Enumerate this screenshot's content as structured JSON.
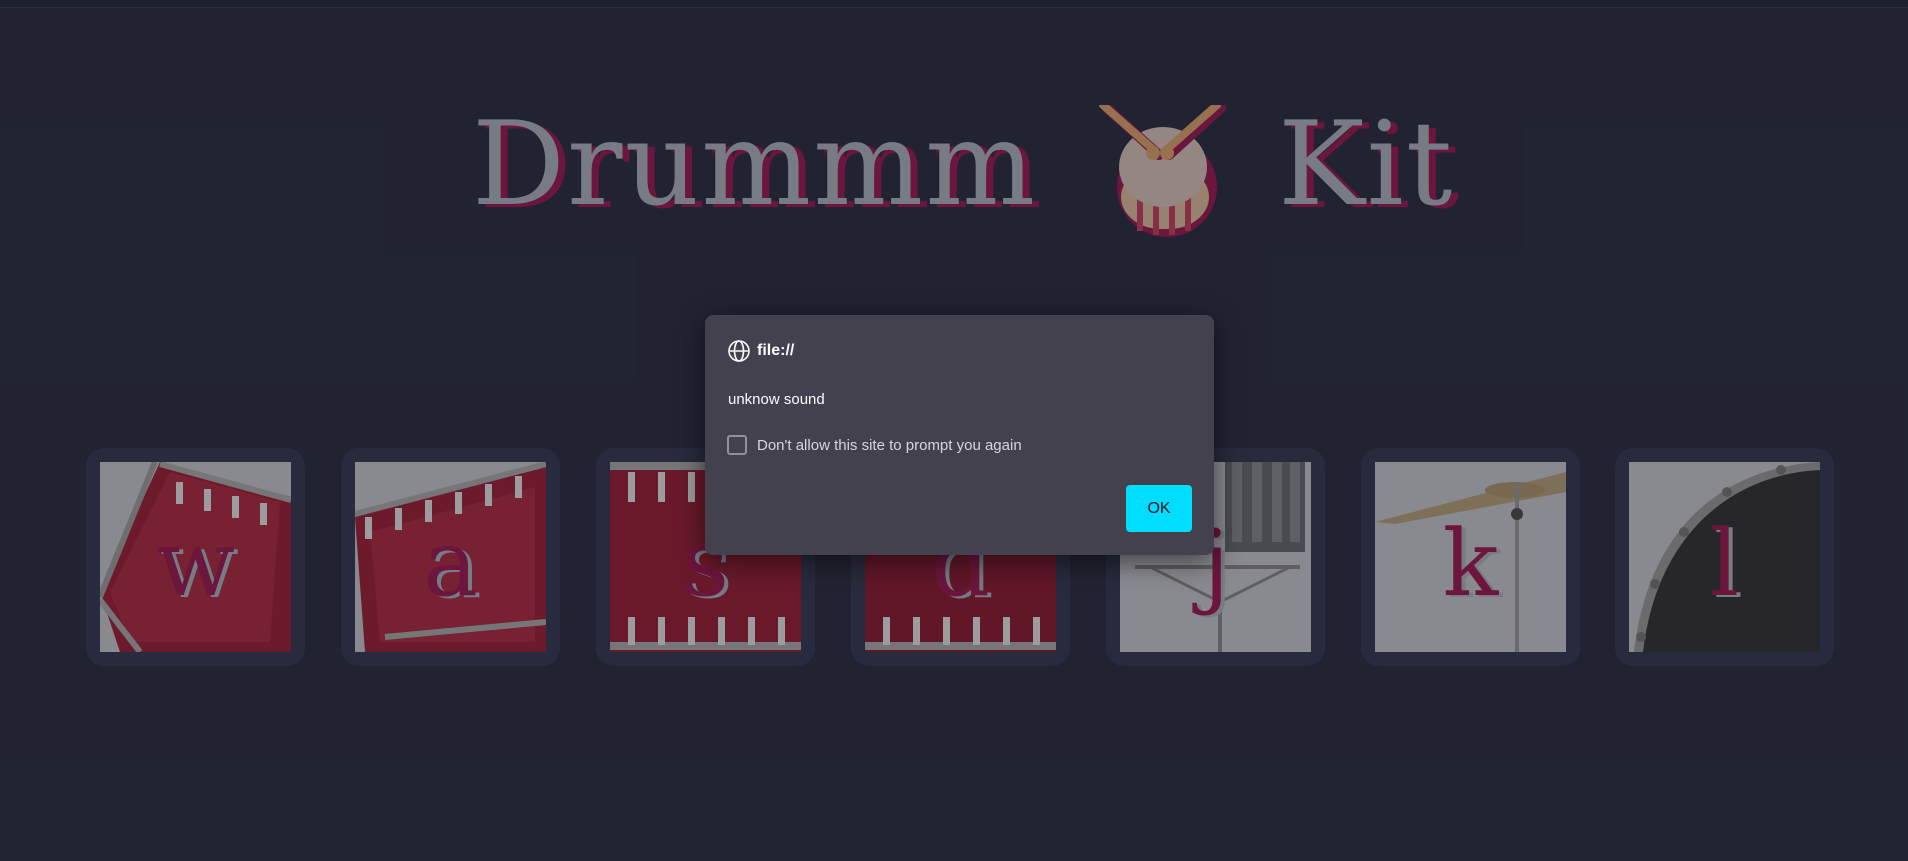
{
  "page": {
    "title_part1": "Drummm",
    "title_part2": "Kit",
    "title_icon": "drum-with-sticks-icon"
  },
  "keys": [
    {
      "letter": "w",
      "image": "tom-drum"
    },
    {
      "letter": "a",
      "image": "tom-drum"
    },
    {
      "letter": "s",
      "image": "snare-drum"
    },
    {
      "letter": "d",
      "image": "snare-drum"
    },
    {
      "letter": "j",
      "image": "hi-hat"
    },
    {
      "letter": "k",
      "image": "cymbal"
    },
    {
      "letter": "l",
      "image": "bass-drum"
    }
  ],
  "dialog": {
    "origin": "file://",
    "origin_icon": "globe-icon",
    "message": "unknow sound",
    "checkbox_label": "Don't allow this site to prompt you again",
    "checkbox_checked": false,
    "ok_label": "OK"
  },
  "colors": {
    "background": "#242838",
    "title_text": "#9aa1aa",
    "accent_crimson": "#8d1447",
    "key_frame": "#2e3347",
    "dialog_bg": "#42414d",
    "ok_button": "#00ddff"
  }
}
